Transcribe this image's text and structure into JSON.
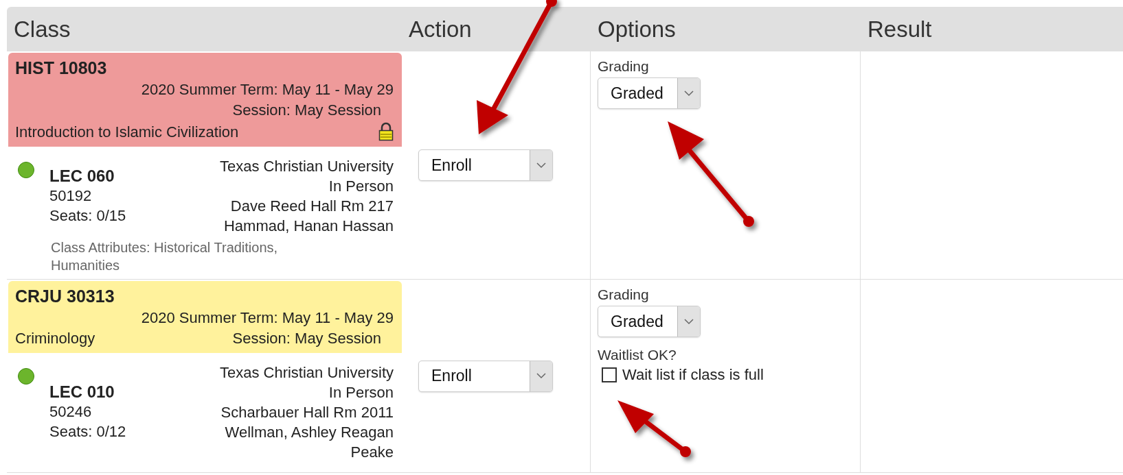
{
  "table": {
    "columns": [
      "Class",
      "Action",
      "Options",
      "Result"
    ],
    "rows": [
      {
        "class": {
          "code": "HIST 10803",
          "term": "2020 Summer Term: May 11 - May 29",
          "session": "Session: May Session",
          "title": "Introduction to Islamic Civilization",
          "kind": "stacked",
          "color": "#ee9a9a",
          "locked": true,
          "section": {
            "component": "LEC 060",
            "number": "50192",
            "seats": "Seats: 0/15",
            "location_lines": [
              "Texas Christian University",
              "In Person",
              "Dave Reed Hall Rm 217",
              "Hammad, Hanan Hassan"
            ],
            "attributes": "Class Attributes: Historical Traditions, Humanities"
          }
        },
        "action": {
          "value": "Enroll"
        },
        "options": [
          {
            "kind": "select",
            "label": "Grading",
            "value": "Graded"
          }
        ]
      },
      {
        "class": {
          "code": "CRJU 30313",
          "term": "2020 Summer Term: May 11 - May 29",
          "session": "Session: May Session",
          "title": "Criminology",
          "kind": "inline",
          "color": "#fff29c",
          "locked": false,
          "section": {
            "component": "LEC 010",
            "number": "50246",
            "seats": "Seats: 0/12",
            "location_lines": [
              "Texas Christian University",
              "In Person",
              "Scharbauer Hall Rm 2011",
              "Wellman, Ashley Reagan",
              "Peake"
            ]
          }
        },
        "action": {
          "value": "Enroll"
        },
        "options": [
          {
            "kind": "select",
            "label": "Grading",
            "value": "Graded"
          },
          {
            "kind": "checkbox",
            "label": "Waitlist OK?",
            "text": "Wait list if class is full",
            "checked": false
          }
        ]
      }
    ]
  }
}
